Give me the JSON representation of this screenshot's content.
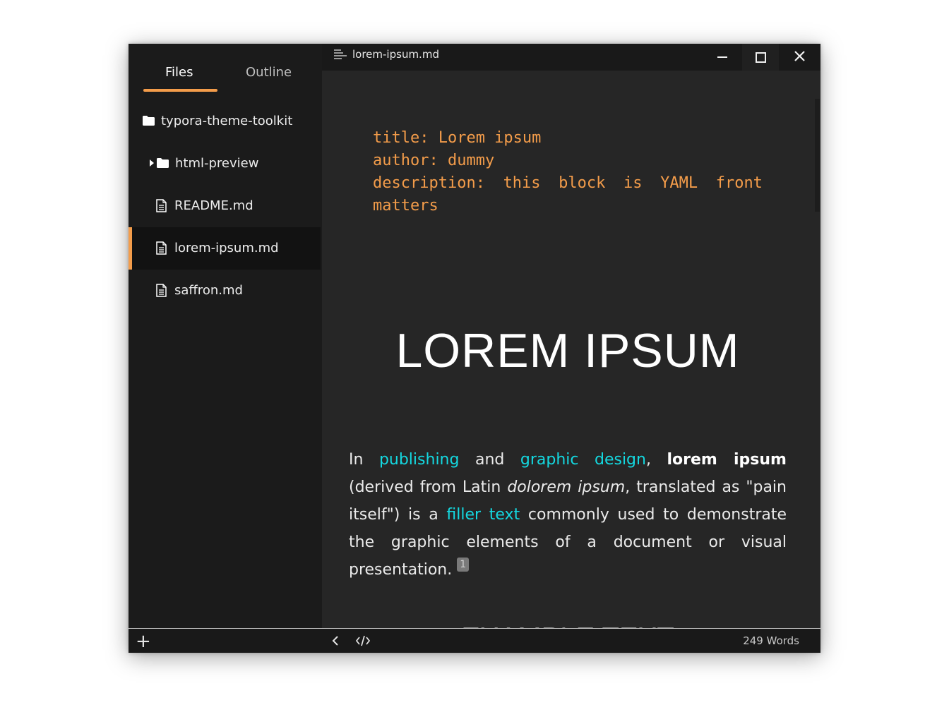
{
  "sidebar": {
    "tabs": [
      {
        "label": "Files",
        "active": true
      },
      {
        "label": "Outline",
        "active": false
      }
    ],
    "files": [
      {
        "label": "typora-theme-toolkit",
        "icon": "folder-icon",
        "type": "root"
      },
      {
        "label": "html-preview",
        "icon": "folder-icon",
        "type": "folder"
      },
      {
        "label": "README.md",
        "icon": "file-icon",
        "type": "file"
      },
      {
        "label": "lorem-ipsum.md",
        "icon": "file-icon",
        "type": "file",
        "active": true
      },
      {
        "label": "saffron.md",
        "icon": "file-icon",
        "type": "file"
      }
    ],
    "add_icon": "plus-icon"
  },
  "titlebar": {
    "title": "lorem-ipsum.md",
    "icons": [
      "menu-icon",
      "minimize-icon",
      "maximize-icon",
      "close-icon"
    ]
  },
  "document": {
    "yaml": {
      "line1": "title: Lorem ipsum",
      "line2": "author: dummy",
      "line3_words": [
        "description:",
        "this",
        "block",
        "is",
        "YAML",
        "front"
      ],
      "line4": "matters"
    },
    "heading": "LOREM IPSUM",
    "paragraph": {
      "t1": "In ",
      "link1": "publishing",
      "t2": " and ",
      "link2": "graphic design",
      "t3": ", ",
      "bold": "lorem ipsum",
      "t4": " (derived from Latin ",
      "italic": "dolorem ipsum",
      "t5": ", translated as \"pain itself\") is a ",
      "link3": "filler text",
      "t6": " commonly used to demonstrate the graphic elements of a document or visual presentation.",
      "footnote": "1"
    },
    "next_heading": "EXAMPLE TEXT"
  },
  "statusbar": {
    "word_count": "249 Words",
    "icons": [
      "chevron-left-icon",
      "source-code-icon"
    ]
  },
  "colors": {
    "accent": "#f39c4a",
    "link": "#14d8e0",
    "sidebar_bg": "#1b1b1b",
    "editor_bg": "#262626"
  }
}
